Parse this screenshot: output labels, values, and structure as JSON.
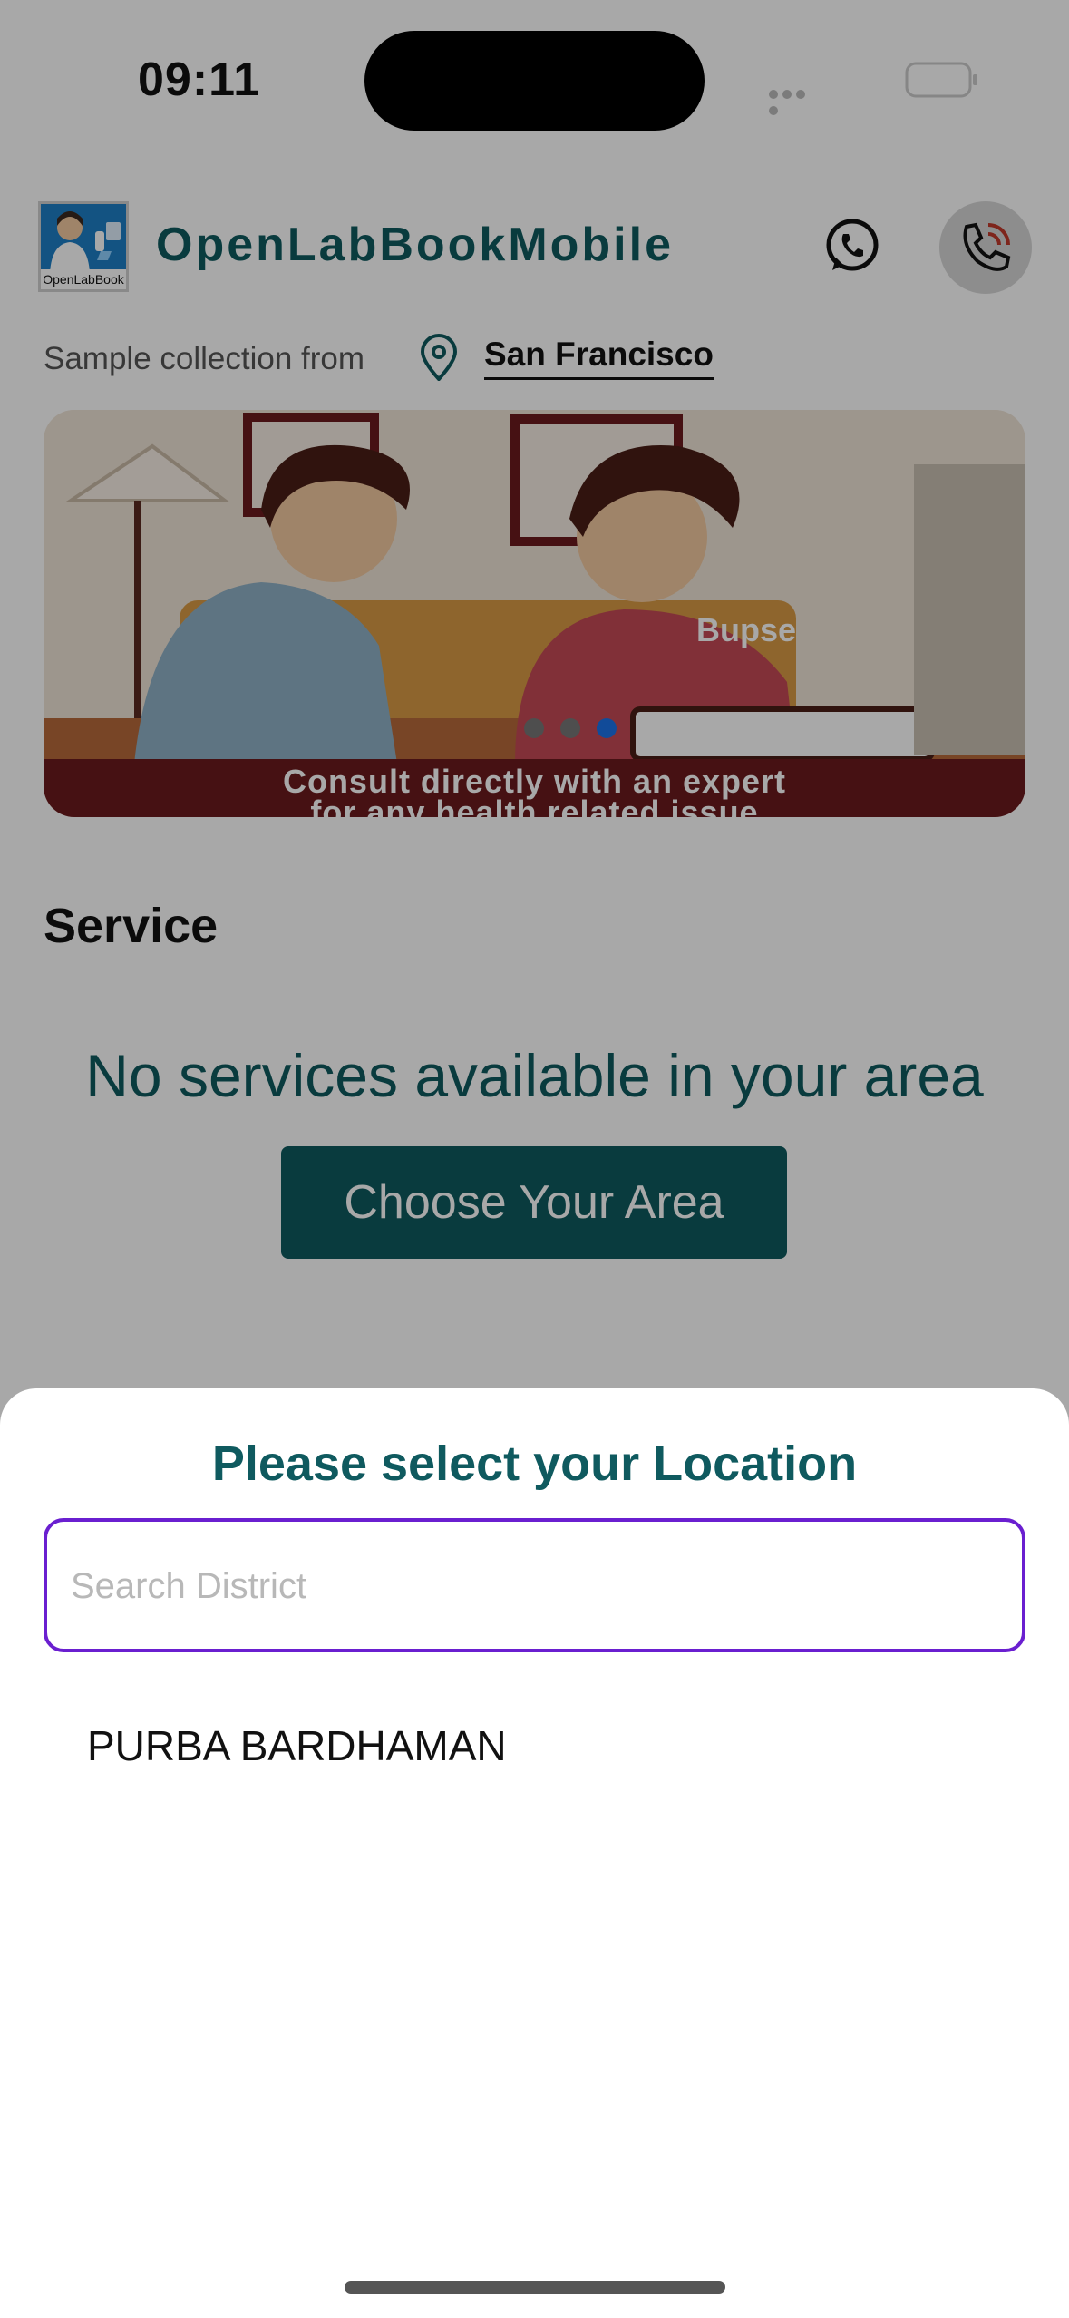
{
  "status_bar": {
    "time": "09:11"
  },
  "header": {
    "app_title": "OpenLabBookMobile",
    "logo_caption": "OpenLabBook",
    "icons": {
      "whatsapp": "whatsapp-icon",
      "call": "phone-call-icon"
    }
  },
  "location": {
    "label": "Sample collection from",
    "city": "San Francisco",
    "icon": "location-pin-icon"
  },
  "banner": {
    "caption_line1": "Consult directly with an expert",
    "caption_line2": "for any health related issue",
    "shirt_text": "Bupse",
    "slides_total": 3,
    "active_slide": 3
  },
  "service": {
    "title": "Service",
    "empty_message": "No services available in your area",
    "choose_button": "Choose Your Area"
  },
  "sheet": {
    "title": "Please select your Location",
    "search_placeholder": "Search District",
    "search_value": "",
    "districts": [
      "PURBA BARDHAMAN"
    ]
  },
  "colors": {
    "brand_teal": "#0f5a5f",
    "input_focus": "#6a1fd0",
    "carousel_active": "#1a73e8"
  }
}
